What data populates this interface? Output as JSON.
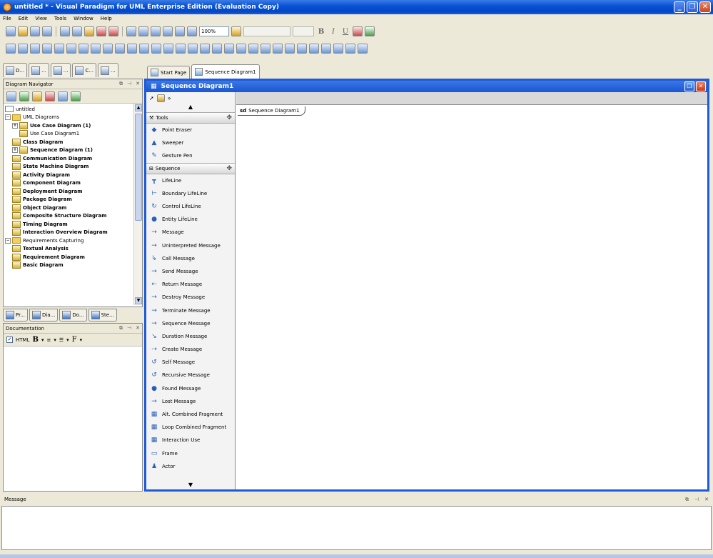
{
  "window": {
    "title": "untitled * - Visual Paradigm for UML Enterprise Edition (Evaluation Copy)"
  },
  "menu": [
    "File",
    "Edit",
    "View",
    "Tools",
    "Window",
    "Help"
  ],
  "toolbar": {
    "zoom_value": "100%",
    "format_bold": "B",
    "format_italic": "I",
    "format_underline": "U"
  },
  "left_tabs": [
    "D...",
    "...",
    "...",
    "C...",
    "..."
  ],
  "navigator": {
    "title": "Diagram Navigator",
    "items": [
      {
        "label": "untitled",
        "level": 0,
        "bold": false,
        "kind": "root"
      },
      {
        "label": "UML Diagrams",
        "level": 0,
        "bold": false,
        "kind": "folder"
      },
      {
        "label": "Use Case Diagram (1)",
        "level": 1,
        "bold": true,
        "kind": "diagram"
      },
      {
        "label": "Use Case Diagram1",
        "level": 2,
        "bold": false,
        "kind": "diagram"
      },
      {
        "label": "Class Diagram",
        "level": 1,
        "bold": true,
        "kind": "diagram"
      },
      {
        "label": "Sequence Diagram (1)",
        "level": 1,
        "bold": true,
        "kind": "diagram"
      },
      {
        "label": "Communication Diagram",
        "level": 1,
        "bold": true,
        "kind": "diagram"
      },
      {
        "label": "State Machine Diagram",
        "level": 1,
        "bold": true,
        "kind": "diagram"
      },
      {
        "label": "Activity Diagram",
        "level": 1,
        "bold": true,
        "kind": "diagram"
      },
      {
        "label": "Component Diagram",
        "level": 1,
        "bold": true,
        "kind": "diagram"
      },
      {
        "label": "Deployment Diagram",
        "level": 1,
        "bold": true,
        "kind": "diagram"
      },
      {
        "label": "Package Diagram",
        "level": 1,
        "bold": true,
        "kind": "diagram"
      },
      {
        "label": "Object Diagram",
        "level": 1,
        "bold": true,
        "kind": "diagram"
      },
      {
        "label": "Composite Structure Diagram",
        "level": 1,
        "bold": true,
        "kind": "diagram"
      },
      {
        "label": "Timing Diagram",
        "level": 1,
        "bold": true,
        "kind": "diagram"
      },
      {
        "label": "Interaction Overview Diagram",
        "level": 1,
        "bold": true,
        "kind": "diagram"
      },
      {
        "label": "Requirements Capturing",
        "level": 0,
        "bold": false,
        "kind": "folder"
      },
      {
        "label": "Textual Analysis",
        "level": 1,
        "bold": true,
        "kind": "diagram"
      },
      {
        "label": "Requirement Diagram",
        "level": 1,
        "bold": true,
        "kind": "diagram"
      },
      {
        "label": "Basic Diagram",
        "level": 1,
        "bold": true,
        "kind": "diagram"
      }
    ]
  },
  "bottom_left_tabs": [
    "Pr...",
    "Dia...",
    "Do...",
    "Ste..."
  ],
  "documentation": {
    "title": "Documentation",
    "html_label": "HTML",
    "bold_btn": "B",
    "font_btn": "F"
  },
  "editor_tabs": [
    "Start Page",
    "Sequence Diagram1"
  ],
  "diagram": {
    "title": "Sequence Diagram1",
    "frame_prefix": "sd",
    "frame_name": "Sequence Diagram1"
  },
  "palette": {
    "tools_group": "Tools",
    "tools": [
      {
        "label": "Point Eraser",
        "icon": "eraser-icon",
        "glyph": "◆"
      },
      {
        "label": "Sweeper",
        "icon": "sweeper-icon",
        "glyph": "▲"
      },
      {
        "label": "Gesture Pen",
        "icon": "pen-icon",
        "glyph": "✎"
      }
    ],
    "sequence_group": "Sequence",
    "sequence": [
      {
        "label": "LifeLine",
        "icon": "lifeline-icon",
        "glyph": "┳"
      },
      {
        "label": "Boundary LifeLine",
        "icon": "boundary-lifeline-icon",
        "glyph": "⊢"
      },
      {
        "label": "Control LifeLine",
        "icon": "control-lifeline-icon",
        "glyph": "↻"
      },
      {
        "label": "Entity LifeLine",
        "icon": "entity-lifeline-icon",
        "glyph": "●"
      },
      {
        "label": "Message",
        "icon": "message-icon",
        "glyph": "→"
      },
      {
        "label": "Uninterpreted Message",
        "icon": "uninterpreted-message-icon",
        "glyph": "→"
      },
      {
        "label": "Call Message",
        "icon": "call-message-icon",
        "glyph": "↳"
      },
      {
        "label": "Send Message",
        "icon": "send-message-icon",
        "glyph": "→"
      },
      {
        "label": "Return Message",
        "icon": "return-message-icon",
        "glyph": "⇠"
      },
      {
        "label": "Destroy Message",
        "icon": "destroy-message-icon",
        "glyph": "→"
      },
      {
        "label": "Terminate Message",
        "icon": "terminate-message-icon",
        "glyph": "→"
      },
      {
        "label": "Sequence Message",
        "icon": "sequence-message-icon",
        "glyph": "→"
      },
      {
        "label": "Duration Message",
        "icon": "duration-message-icon",
        "glyph": "↘"
      },
      {
        "label": "Create Message",
        "icon": "create-message-icon",
        "glyph": "⇢"
      },
      {
        "label": "Self Message",
        "icon": "self-message-icon",
        "glyph": "↺"
      },
      {
        "label": "Recursive Message",
        "icon": "recursive-message-icon",
        "glyph": "↺"
      },
      {
        "label": "Found Message",
        "icon": "found-message-icon",
        "glyph": "●"
      },
      {
        "label": "Lost Message",
        "icon": "lost-message-icon",
        "glyph": "→"
      },
      {
        "label": "Alt. Combined Fragment",
        "icon": "alt-fragment-icon",
        "glyph": "▦"
      },
      {
        "label": "Loop Combined Fragment",
        "icon": "loop-fragment-icon",
        "glyph": "▦"
      },
      {
        "label": "Interaction Use",
        "icon": "interaction-use-icon",
        "glyph": "▦"
      },
      {
        "label": "Frame",
        "icon": "frame-icon",
        "glyph": "▭"
      },
      {
        "label": "Actor",
        "icon": "actor-icon",
        "glyph": "♟"
      }
    ]
  },
  "message_panel": {
    "title": "Message"
  }
}
